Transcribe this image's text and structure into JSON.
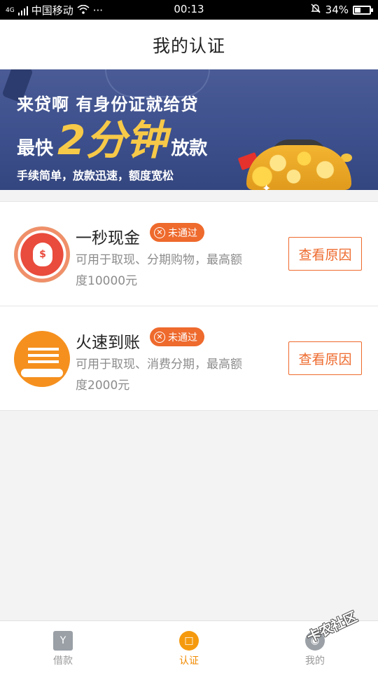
{
  "status_bar": {
    "carrier": "中国移动",
    "network": "4G",
    "dots": "···",
    "time": "00:13",
    "battery": "34%"
  },
  "header": {
    "title": "我的认证"
  },
  "banner": {
    "line1": "来贷啊 有身份证就给贷",
    "line2_prefix": "最快",
    "line2_big": "2分钟",
    "line2_suffix": "放款",
    "line3": "手续简单，放款迅速，额度宽松"
  },
  "cards": [
    {
      "name": "一秒现金",
      "status": "未通过",
      "desc": "可用于取现、分期购物，最高额度10000元",
      "button": "查看原因",
      "icon": "money-bag-icon"
    },
    {
      "name": "火速到账",
      "status": "未通过",
      "desc": "可用于取现、消费分期，最高额度2000元",
      "button": "查看原因",
      "icon": "fire-arrival-icon"
    }
  ],
  "tabbar": {
    "tabs": [
      {
        "label": "借款",
        "icon": "loan-icon",
        "active": false
      },
      {
        "label": "认证",
        "icon": "certify-icon",
        "active": true
      },
      {
        "label": "我的",
        "icon": "profile-icon",
        "active": false
      }
    ]
  },
  "watermark": "卡农社区",
  "colors": {
    "accent": "#ee6a2d",
    "tab_active": "#f08a00",
    "banner_bg": "#3c4f8c"
  }
}
